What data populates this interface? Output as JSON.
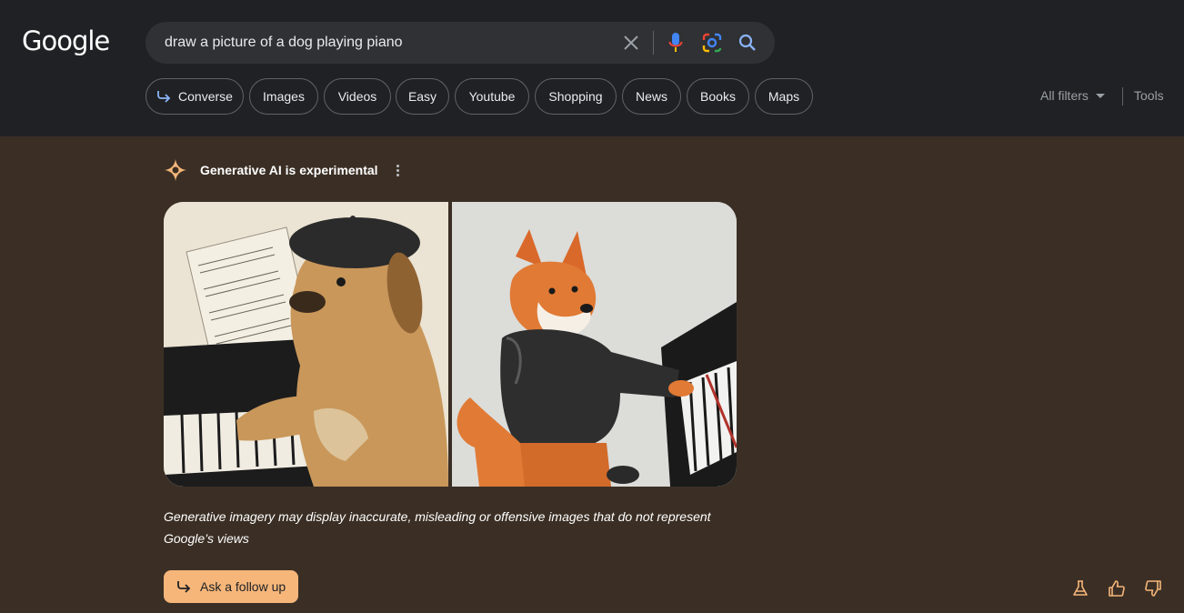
{
  "header": {
    "logo": "Google",
    "search": {
      "query": "draw a picture of a dog playing piano",
      "icons": [
        "close-icon",
        "microphone-icon",
        "lens-icon",
        "search-icon"
      ]
    },
    "chips": [
      {
        "label": "Converse",
        "icon": "converse-arrow-icon"
      },
      {
        "label": "Images"
      },
      {
        "label": "Videos"
      },
      {
        "label": "Easy"
      },
      {
        "label": "Youtube"
      },
      {
        "label": "Shopping"
      },
      {
        "label": "News"
      },
      {
        "label": "Books"
      },
      {
        "label": "Maps"
      }
    ],
    "all_filters_label": "All filters",
    "tools_label": "Tools"
  },
  "ai": {
    "title": "Generative AI is experimental",
    "images": [
      {
        "alt": "dog-in-beret-playing-piano-sketch"
      },
      {
        "alt": "shiba-inu-in-leather-jacket-playing-piano"
      }
    ],
    "disclaimer": "Generative imagery may display inaccurate, misleading or offensive images that do not represent Google’s views",
    "follow_up_label": "Ask a follow up",
    "feedback_icons": [
      "labs-flask-icon",
      "thumbs-up-icon",
      "thumbs-down-icon"
    ]
  },
  "colors": {
    "header_bg": "#202124",
    "page_bg": "#3b2f25",
    "accent": "#f6b67a",
    "search_blue": "#8ab4f8"
  }
}
